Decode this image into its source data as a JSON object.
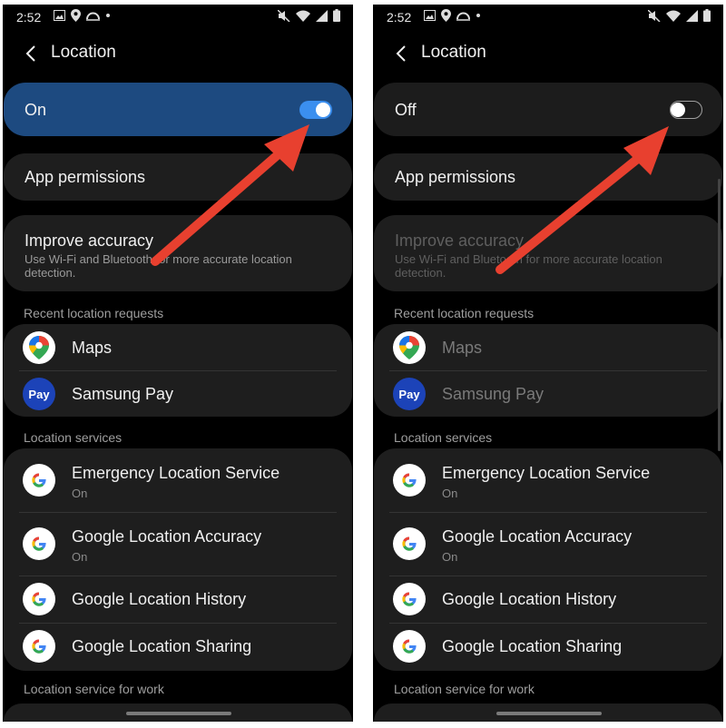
{
  "colors": {
    "accent_blue": "#3b8fef",
    "on_card": "#1d4a80",
    "card": "#1e1e1e",
    "background": "#000000",
    "arrow_red": "#e8402f"
  },
  "status": {
    "time": "2:52"
  },
  "screens": [
    {
      "title": "Location",
      "main_toggle": {
        "label": "On",
        "state": "on"
      },
      "app_permissions": "App permissions",
      "improve_accuracy": {
        "title": "Improve accuracy",
        "description": "Use Wi-Fi and Bluetooth for more accurate location detection."
      },
      "recent_header": "Recent location requests",
      "recent": [
        {
          "icon": "maps-icon",
          "name": "Maps"
        },
        {
          "icon": "samsung-pay-icon",
          "name": "Samsung Pay",
          "badge": "Pay"
        }
      ],
      "services_header": "Location services",
      "services": [
        {
          "icon": "google-icon",
          "name": "Emergency Location Service",
          "status": "On"
        },
        {
          "icon": "google-icon",
          "name": "Google Location Accuracy",
          "status": "On"
        },
        {
          "icon": "google-icon",
          "name": "Google Location History"
        },
        {
          "icon": "google-icon",
          "name": "Google Location Sharing"
        }
      ],
      "work_header": "Location service for work"
    },
    {
      "title": "Location",
      "main_toggle": {
        "label": "Off",
        "state": "off"
      },
      "app_permissions": "App permissions",
      "improve_accuracy": {
        "title": "Improve accuracy",
        "description": "Use Wi-Fi and Bluetooth for more accurate location detection."
      },
      "recent_header": "Recent location requests",
      "recent": [
        {
          "icon": "maps-icon",
          "name": "Maps"
        },
        {
          "icon": "samsung-pay-icon",
          "name": "Samsung Pay",
          "badge": "Pay"
        }
      ],
      "services_header": "Location services",
      "services": [
        {
          "icon": "google-icon",
          "name": "Emergency Location Service",
          "status": "On"
        },
        {
          "icon": "google-icon",
          "name": "Google Location Accuracy",
          "status": "On"
        },
        {
          "icon": "google-icon",
          "name": "Google Location History"
        },
        {
          "icon": "google-icon",
          "name": "Google Location Sharing"
        }
      ],
      "work_header": "Location service for work"
    }
  ]
}
